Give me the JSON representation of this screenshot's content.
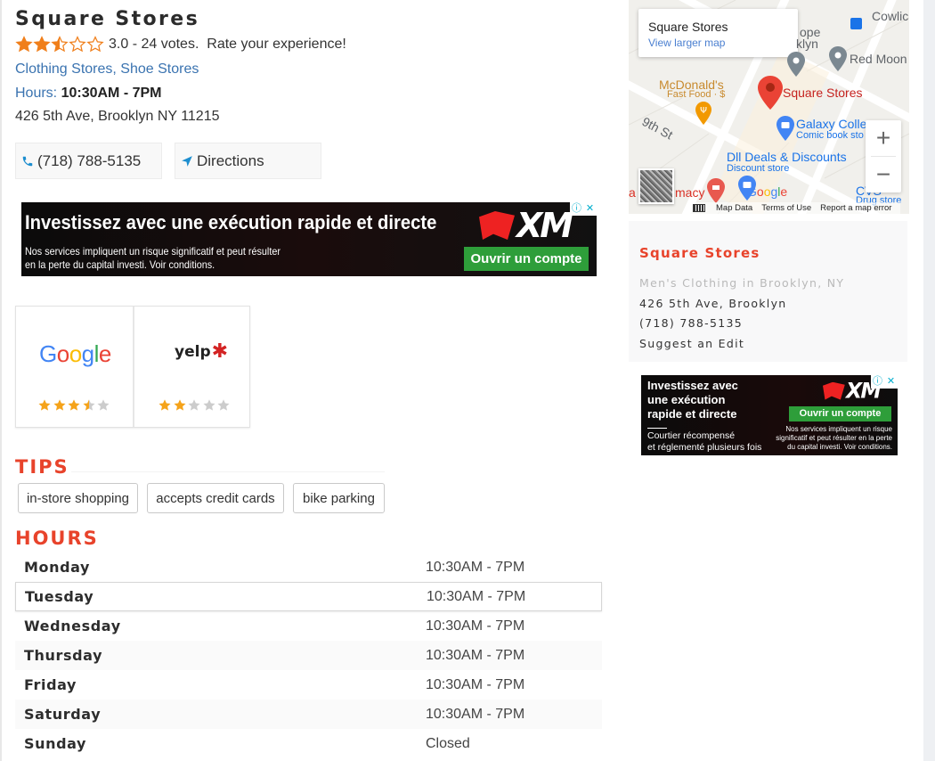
{
  "business": {
    "name": "Square Stores",
    "rating_value": 3.0,
    "rating_text": "3.0 - 24 votes.",
    "rate_prompt": "Rate your experience!",
    "categories": [
      "Clothing Stores",
      "Shoe Stores"
    ],
    "category_separator": ",",
    "hours_label": "Hours:",
    "hours_value": "10:30AM - 7PM",
    "address": "426 5th Ave, Brooklyn NY 11215"
  },
  "actions": {
    "phone_label": "(718) 788-5135",
    "directions_label": "Directions"
  },
  "ad_wide": {
    "headline": "Investissez avec une exécution rapide et directe",
    "disclaimer_line1": "Nos services impliquent un risque significatif et peut résulter",
    "disclaimer_line2": "en la perte du capital investi. Voir conditions.",
    "brand": "XM",
    "cta": "Ouvrir un compte",
    "info_icon": "ⓘ",
    "close_icon": "✕"
  },
  "reviews": [
    {
      "source": "Google",
      "stars": 3.5
    },
    {
      "source": "yelp",
      "stars": 2
    }
  ],
  "tips": {
    "heading": "TIPS",
    "items": [
      "in-store shopping",
      "accepts credit cards",
      "bike parking"
    ]
  },
  "hours": {
    "heading": "HOURS",
    "today_index": 1,
    "rows": [
      {
        "day": "Monday",
        "time": "10:30AM - 7PM"
      },
      {
        "day": "Tuesday",
        "time": "10:30AM - 7PM"
      },
      {
        "day": "Wednesday",
        "time": "10:30AM - 7PM"
      },
      {
        "day": "Thursday",
        "time": "10:30AM - 7PM"
      },
      {
        "day": "Friday",
        "time": "10:30AM - 7PM"
      },
      {
        "day": "Saturday",
        "time": "10:30AM - 7PM"
      },
      {
        "day": "Sunday",
        "time": "Closed"
      }
    ]
  },
  "map": {
    "card_title": "Square Stores",
    "card_link": "View larger map",
    "labels": {
      "cowlic": "Cowlic",
      "hope": "ope",
      "klyn": "klyn",
      "red_moon": "Red Moon",
      "mcdonalds": "McDonald's",
      "mcdonalds_sub": "Fast Food · $",
      "square_stores": "Square Stores",
      "ninth_st": "9th St",
      "galaxy": "Galaxy Colle",
      "galaxy_sub": "Comic book sto",
      "dll": "Dll Deals & Discounts",
      "dll_sub": "Discount store",
      "pharmacy_left": "a",
      "pharmacy": "macy",
      "google": "Google",
      "cvs": "CVS",
      "cvs_sub": "Drug store"
    },
    "zoom_in": "+",
    "zoom_out": "−",
    "footer": [
      "Map Data",
      "Terms of Use",
      "Report a map error"
    ]
  },
  "info_card": {
    "name": "Square Stores",
    "category_line": "Men's Clothing in Brooklyn, NY",
    "address": "426 5th Ave, Brooklyn",
    "phone": "(718) 788-5135",
    "suggest_edit": "Suggest an Edit"
  },
  "ad_small": {
    "headline_1": "Investissez avec",
    "headline_2": "une exécution",
    "headline_3": "rapide et directe",
    "sub_1": "Courtier récompensé",
    "sub_2": "et réglementé plusieurs fois",
    "brand": "XM",
    "cta": "Ouvrir un compte",
    "disclaimer": "Nos services impliquent un risque significatif et peut résulter en la perte du capital investi. Voir conditions.",
    "info_icon": "ⓘ",
    "close_icon": "✕"
  },
  "colors": {
    "accent_red": "#e8432b",
    "link_blue": "#3a73b0",
    "star_orange": "#f07f1b",
    "star_gold": "#f5a31a",
    "star_empty": "#cccccc",
    "ad_cta_green": "#2e9e3a"
  }
}
